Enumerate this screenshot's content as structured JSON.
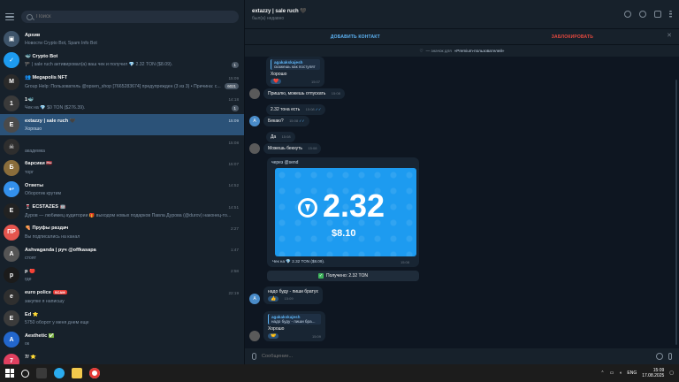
{
  "left": {
    "search_placeholder": "Поиск",
    "chats": [
      {
        "name": "Архив",
        "preview": "Новости Crypto Bot, Spam Info Bot",
        "time": "",
        "badge": "",
        "avatar_color": "#3e546a",
        "initial": "▣"
      },
      {
        "name": "🐳 Crypto Bot",
        "preview": "🏴 | sale ruch активировал(а) ваш чек и получил 💎 2.32 TON ($8.09).",
        "time": "",
        "badge": "1",
        "avatar_color": "#1d9bf0",
        "initial": "✓"
      },
      {
        "name": "👥 Megapolis NFT",
        "preview": "Group Help: Пользователь @opsen_shop [7665283674] предупрежден (3 из 3) • Причина: с...",
        "time": "15:09",
        "badge": "6021",
        "avatar_color": "#2a2a2a",
        "initial": "M"
      },
      {
        "name": "1🐳",
        "preview": "Чек на 💎 $0 TON ($276.39).",
        "time": "14:18",
        "badge": "1",
        "avatar_color": "#3a3a3a",
        "initial": "1"
      },
      {
        "name": "extazzy | sale ruch 🖤",
        "preview": "Хорошо",
        "time": "15:09",
        "badge": "",
        "avatar_color": "#4a4a4a",
        "initial": "E"
      },
      {
        "name": "",
        "preview": "академка",
        "time": "15:08",
        "badge": "",
        "avatar_color": "#2e2e2e",
        "initial": "☠"
      },
      {
        "name": "барсики 🇱🇻",
        "preview": "торг",
        "time": "15:07",
        "badge": "",
        "avatar_color": "#8a6d3b",
        "initial": "Б"
      },
      {
        "name": "Ответы",
        "preview": "Оборотик крутим",
        "time": "14:52",
        "badge": "",
        "avatar_color": "#3390ec",
        "initial": "↩"
      },
      {
        "name": "🍷 ECSTAZES 🤖",
        "preview": "Дуров — любимец аудитории 🎁 выходом новых подарков Павла Дурова (@durov) наконец-то...",
        "time": "14:51",
        "badge": "",
        "avatar_color": "#222222",
        "initial": "E"
      },
      {
        "name": "🍕 Пруфы раздач",
        "preview": "Вы подписались на канал",
        "time": "2:27",
        "badge": "",
        "avatar_color": "#e5554e",
        "initial": "ПР"
      },
      {
        "name": "Ashvaganda | руч @offkasapa",
        "preview": "стоят",
        "time": "1:47",
        "badge": "",
        "avatar_color": "#555555",
        "initial": "A"
      },
      {
        "name": "р 🔴",
        "preview": "где",
        "time": "2:58",
        "badge": "",
        "avatar_color": "#1b1b1b",
        "initial": "p"
      },
      {
        "name": "euro police",
        "tag": "SCAM",
        "preview": "закупке я написшу",
        "time": "22:19",
        "badge": "",
        "avatar_color": "#2f2f2f",
        "initial": "e"
      },
      {
        "name": "Ed ⭐",
        "preview": "5750 оборот у меня днем еще",
        "time": "",
        "badge": "",
        "avatar_color": "#3b3b3b",
        "initial": "E"
      },
      {
        "name": "Aesthetic ✅",
        "preview": "ок",
        "time": "",
        "badge": "",
        "avatar_color": "#2266cc",
        "initial": "A"
      },
      {
        "name": "7/ ⭐",
        "preview": "",
        "time": "",
        "badge": "",
        "avatar_color": "#e04060",
        "initial": "7"
      }
    ]
  },
  "header": {
    "title": "extazzy | sale ruch 🖤",
    "subtitle": "был(а) недавно"
  },
  "actions": {
    "add_contact": "ДОБАВИТЬ КОНТАКТ",
    "block": "ЗАБЛОКИРОВАТЬ",
    "premium_prefix": "— значок для",
    "premium_link": "Premium-пользователей",
    "premium_suffix": "»"
  },
  "messages": [
    {
      "quote_name": "agakakskajesh",
      "quote_text": "скажешь как поступят",
      "text": "Хорошо",
      "time": "15:07",
      "reaction": "❤️"
    },
    {
      "text": "Пришлю, можешь отпускать",
      "time": "15:08"
    },
    {
      "text": "2.32 тона есть",
      "time": "15:08"
    },
    {
      "text": "Бекаю?",
      "time": "15:08"
    },
    {
      "text": "Да",
      "time": "15:08"
    },
    {
      "text": "Можешь бекнуть",
      "time": "15:08"
    }
  ],
  "card": {
    "link": "через @send",
    "amount": "2.32",
    "usd": "$8.10",
    "footer": "Чек на 💎 2.32 TON ($8.09).",
    "time": "15:08"
  },
  "received": "Получено: 2.32 TON",
  "later_messages": [
    {
      "text": "надо буду - пиши братух",
      "time": "15:09",
      "reaction": "👍"
    },
    {
      "quote_name": "agakakskajesh",
      "quote_text": "надо буду - пиши бра...",
      "text": "Хорошо",
      "time": "15:09",
      "reaction": "🤝"
    }
  ],
  "composer": {
    "placeholder": "Сообщение..."
  },
  "taskbar": {
    "lang": "ENG",
    "time": "15:09",
    "date": "17.08.2025"
  }
}
